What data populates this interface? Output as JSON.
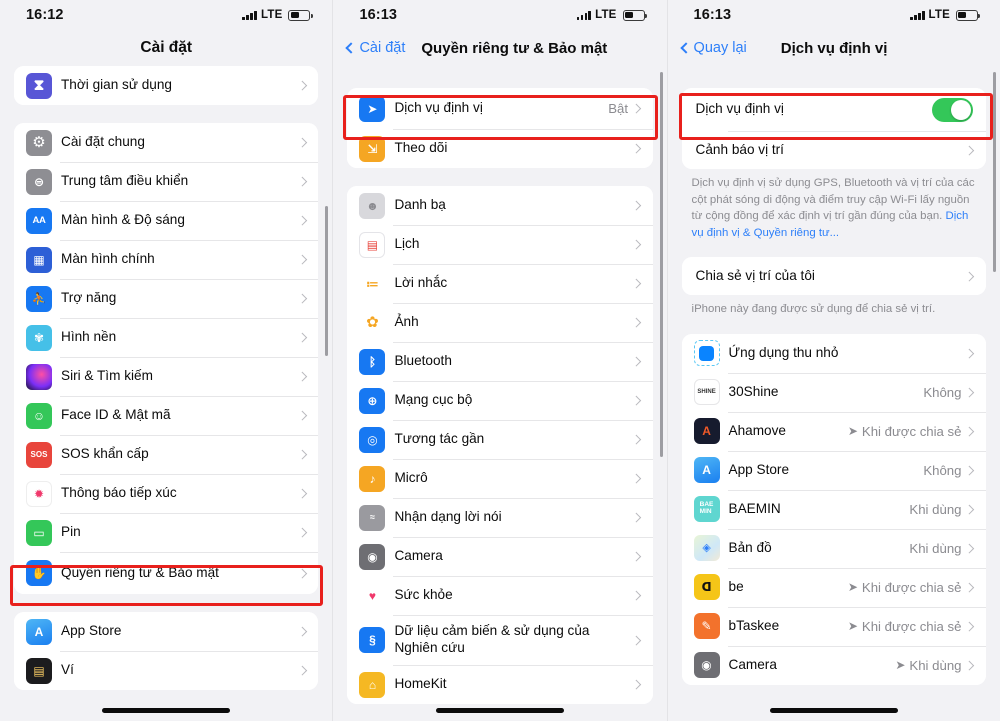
{
  "panels": [
    {
      "id": "settings",
      "status": {
        "time": "16:12",
        "carrier": "LTE"
      },
      "nav": {
        "title": "Cài đặt"
      },
      "groups": [
        {
          "rows": [
            {
              "label": "Thời gian sử dụng",
              "icon": "screentime-icon",
              "icon_color": "#5856d6",
              "glyph": "⧖",
              "chevron": true
            }
          ]
        },
        {
          "rows": [
            {
              "label": "Cài đặt chung",
              "icon": "gear-icon",
              "icon_color": "#8e8e93",
              "glyph": "⚙",
              "chevron": true
            },
            {
              "label": "Trung tâm điều khiển",
              "icon": "control-center-icon",
              "icon_color": "#8e8e93",
              "glyph": "⊟",
              "chevron": true
            },
            {
              "label": "Màn hình & Độ sáng",
              "icon": "display-brightness-icon",
              "icon_color": "#1778f2",
              "glyph": "AA",
              "chevron": true
            },
            {
              "label": "Màn hình chính",
              "icon": "home-screen-icon",
              "icon_color": "#2d5fd6",
              "glyph": "▦",
              "chevron": true
            },
            {
              "label": "Trợ năng",
              "icon": "accessibility-icon",
              "icon_color": "#1778f2",
              "glyph": "♿",
              "chevron": true
            },
            {
              "label": "Hình nền",
              "icon": "wallpaper-icon",
              "icon_color": "#45c0e8",
              "glyph": "✾",
              "chevron": true
            },
            {
              "label": "Siri & Tìm kiếm",
              "icon": "siri-icon",
              "icon_color": "#1b1030",
              "glyph": "◉",
              "chevron": true
            },
            {
              "label": "Face ID & Mật mã",
              "icon": "faceid-icon",
              "icon_color": "#34c759",
              "glyph": "☺",
              "chevron": true
            },
            {
              "label": "SOS khẩn cấp",
              "icon": "sos-icon",
              "icon_color": "#e8453c",
              "glyph": "SOS",
              "chevron": true
            },
            {
              "label": "Thông báo tiếp xúc",
              "icon": "exposure-notification-icon",
              "icon_color": "#ffffff",
              "glyph": "✹",
              "chevron": true
            },
            {
              "label": "Pin",
              "icon": "battery-icon",
              "icon_color": "#34c759",
              "glyph": "▭",
              "chevron": true
            },
            {
              "label": "Quyền riêng tư & Bảo mật",
              "icon": "privacy-hand-icon",
              "icon_color": "#1778f2",
              "glyph": "✋",
              "chevron": true,
              "highlighted": true
            }
          ]
        },
        {
          "rows": [
            {
              "label": "App Store",
              "icon": "app-store-icon",
              "icon_color": "#3ea6f0",
              "glyph": "Ⓐ",
              "chevron": true
            },
            {
              "label": "Ví",
              "icon": "wallet-icon",
              "icon_color": "#1c1c1e",
              "glyph": "▤",
              "chevron": true
            }
          ]
        }
      ]
    },
    {
      "id": "privacy",
      "status": {
        "time": "16:13",
        "carrier": "LTE"
      },
      "nav": {
        "back_label": "Cài đặt",
        "title": "Quyền riêng tư & Bảo mật"
      },
      "groups": [
        {
          "rows": [
            {
              "label": "Dịch vụ định vị",
              "icon": "location-arrow-icon",
              "icon_color": "#1778f2",
              "glyph": "➤",
              "value": "Bật",
              "chevron": true,
              "highlighted": true
            },
            {
              "label": "Theo dõi",
              "icon": "tracking-icon",
              "icon_color": "#f5a623",
              "glyph": "⇲",
              "chevron": true
            }
          ]
        },
        {
          "rows": [
            {
              "label": "Danh bạ",
              "icon": "contacts-icon",
              "icon_color": "#d8d8dc",
              "glyph": "👤",
              "chevron": true
            },
            {
              "label": "Lịch",
              "icon": "calendar-icon",
              "icon_color": "#ffffff",
              "glyph": "▤",
              "chevron": true
            },
            {
              "label": "Lời nhắc",
              "icon": "reminders-icon",
              "icon_color": "#ffffff",
              "glyph": "≔",
              "chevron": true
            },
            {
              "label": "Ảnh",
              "icon": "photos-icon",
              "icon_color": "#ffffff",
              "glyph": "✿",
              "chevron": true
            },
            {
              "label": "Bluetooth",
              "icon": "bluetooth-icon",
              "icon_color": "#1778f2",
              "glyph": "ᛒ",
              "chevron": true
            },
            {
              "label": "Mạng cục bộ",
              "icon": "local-network-icon",
              "icon_color": "#1778f2",
              "glyph": "⊕",
              "chevron": true
            },
            {
              "label": "Tương tác gần",
              "icon": "nearby-interactions-icon",
              "icon_color": "#1778f2",
              "glyph": "◎",
              "chevron": true
            },
            {
              "label": "Micrô",
              "icon": "microphone-icon",
              "icon_color": "#f5a623",
              "glyph": "🎤",
              "chevron": true
            },
            {
              "label": "Nhận dạng lời nói",
              "icon": "speech-recognition-icon",
              "icon_color": "#9a9a9f",
              "glyph": "⋮⋮",
              "chevron": true
            },
            {
              "label": "Camera",
              "icon": "camera-icon",
              "icon_color": "#6e6e73",
              "glyph": "◉",
              "chevron": true
            },
            {
              "label": "Sức khỏe",
              "icon": "health-icon",
              "icon_color": "#ffffff",
              "glyph": "♥",
              "chevron": true
            },
            {
              "label": "Dữ liệu cảm biến & sử dụng của Nghiên cứu",
              "icon": "research-sensor-icon",
              "icon_color": "#1778f2",
              "glyph": "§",
              "chevron": true
            },
            {
              "label": "HomeKit",
              "icon": "homekit-icon",
              "icon_color": "#f5b823",
              "glyph": "⌂",
              "chevron": true
            }
          ]
        }
      ]
    },
    {
      "id": "location-services",
      "status": {
        "time": "16:13",
        "carrier": "LTE"
      },
      "nav": {
        "back_label": "Quay lại",
        "title": "Dịch vụ định vị"
      },
      "groups": [
        {
          "highlighted_group": true,
          "rows": [
            {
              "label": "Dịch vụ định vị",
              "toggle": true,
              "toggle_on": true,
              "highlighted": true
            },
            {
              "label": "Cảnh báo vị trí",
              "chevron": true
            }
          ]
        }
      ],
      "footnote1": "Dịch vụ định vị sử dụng GPS, Bluetooth và vị trí của các cột phát sóng di động và điểm truy cập Wi-Fi lấy nguồn từ cộng đồng để xác định vị trí gần đúng của bạn. ",
      "footnote1_link": "Dịch vụ định vị & Quyền riêng tư...",
      "share_group": {
        "rows": [
          {
            "label": "Chia sẻ vị trí của tôi",
            "chevron": true
          }
        ]
      },
      "footnote2": "iPhone này đang được sử dụng để chia sẻ vị trí.",
      "apps": [
        {
          "label": "Ứng dụng thu nhỏ",
          "icon": "app-clips-icon",
          "icon_color": "#0a84ff",
          "value": "",
          "arrow": false,
          "chevron": true
        },
        {
          "label": "30Shine",
          "icon": "30shine-icon",
          "icon_color": "#ffffff",
          "value": "Không",
          "arrow": false,
          "chevron": true
        },
        {
          "label": "Ahamove",
          "icon": "ahamove-icon",
          "icon_color": "#161b2e",
          "value": "Khi được chia sẻ",
          "arrow": true,
          "chevron": true
        },
        {
          "label": "App Store",
          "icon": "app-store-icon",
          "icon_color": "#3ea6f0",
          "value": "Không",
          "arrow": false,
          "chevron": true
        },
        {
          "label": "BAEMIN",
          "icon": "baemin-icon",
          "icon_color": "#5fd6d0",
          "value": "Khi dùng",
          "arrow": false,
          "chevron": true
        },
        {
          "label": "Bản đồ",
          "icon": "maps-icon",
          "icon_color": "#ffffff",
          "value": "Khi dùng",
          "arrow": false,
          "chevron": true
        },
        {
          "label": "be",
          "icon": "be-icon",
          "icon_color": "#f5c518",
          "value": "Khi được chia sẻ",
          "arrow": true,
          "chevron": true
        },
        {
          "label": "bTaskee",
          "icon": "btaskee-icon",
          "icon_color": "#f3722c",
          "value": "Khi được chia sẻ",
          "arrow": true,
          "chevron": true
        },
        {
          "label": "Camera",
          "icon": "camera-icon",
          "icon_color": "#6e6e73",
          "value": "Khi dùng",
          "arrow": true,
          "chevron": true
        }
      ]
    }
  ],
  "colors": {
    "highlight_red": "#e8201c",
    "ios_blue": "#2d7ff9",
    "toggle_green": "#34c759",
    "page_bg": "#f2f2f5",
    "card_bg": "#ffffff",
    "secondary_text": "#8b8b90"
  }
}
